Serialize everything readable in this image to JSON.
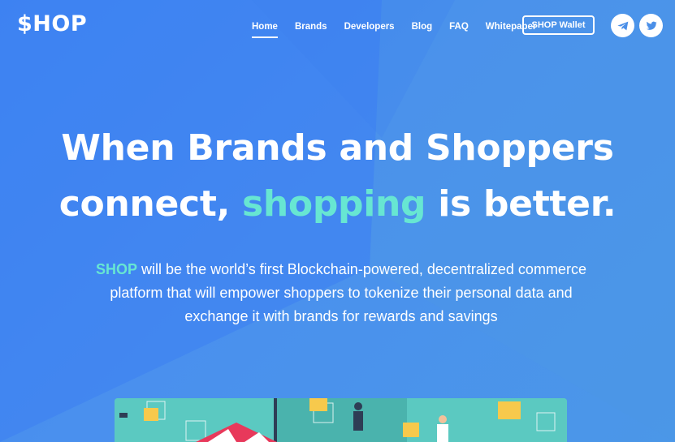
{
  "header": {
    "logo": "$HOP",
    "nav": [
      "Home",
      "Brands",
      "Developers",
      "Blog",
      "FAQ",
      "Whitepaper"
    ],
    "active_nav": "Home",
    "wallet_button": "SHOP Wallet",
    "social": [
      "telegram-icon",
      "twitter-icon"
    ]
  },
  "hero": {
    "headline_line1": "When Brands and Shoppers",
    "headline_line2_pre": "connect, ",
    "headline_line2_accent": "shopping",
    "headline_line2_post": " is better.",
    "sub_brand": "SHOP",
    "sub_text": " will be the world’s first Blockchain-powered, decentralized commerce platform that will empower shoppers to tokenize their personal data and exchange it with brands for rewards and savings"
  },
  "colors": {
    "background": "#4189f1",
    "accent": "#67e6d2",
    "text": "#ffffff"
  }
}
